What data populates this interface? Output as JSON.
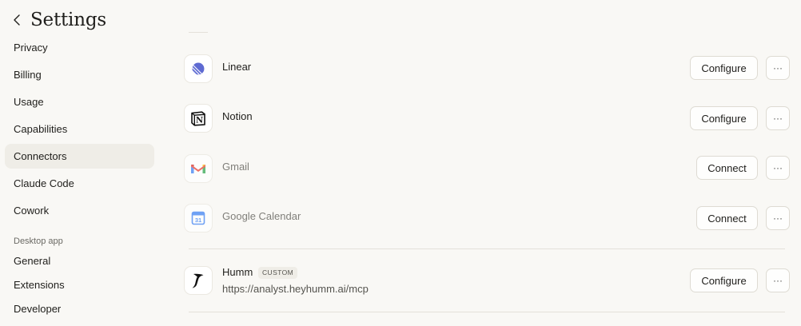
{
  "header": {
    "back_glyph": "‹",
    "title": "Settings"
  },
  "sidebar": {
    "items": [
      {
        "label": "Privacy"
      },
      {
        "label": "Billing"
      },
      {
        "label": "Usage"
      },
      {
        "label": "Capabilities"
      },
      {
        "label": "Connectors",
        "active": true
      },
      {
        "label": "Claude Code"
      },
      {
        "label": "Cowork"
      }
    ],
    "section_label": "Desktop app",
    "desktop_items": [
      {
        "label": "General"
      },
      {
        "label": "Extensions"
      },
      {
        "label": "Developer"
      }
    ]
  },
  "connectors": [
    {
      "name": "Linear",
      "icon": "linear-icon",
      "action": "Configure",
      "more": "···",
      "connected": true
    },
    {
      "name": "Notion",
      "icon": "notion-icon",
      "action": "Configure",
      "more": "···",
      "connected": true
    },
    {
      "name": "Gmail",
      "icon": "gmail-icon",
      "action": "Connect",
      "more": "···",
      "connected": false
    },
    {
      "name": "Google Calendar",
      "icon": "google-calendar-icon",
      "calendar_day": "31",
      "action": "Connect",
      "more": "···",
      "connected": false
    },
    {
      "name": "Humm",
      "badge": "CUSTOM",
      "url": "https://analyst.heyhumm.ai/mcp",
      "icon": "humm-icon",
      "action": "Configure",
      "more": "···",
      "connected": true
    }
  ],
  "colors": {
    "background": "#f9f8f5",
    "active_nav": "#efede7",
    "linear_accent": "#5e6ad2",
    "gmail_red": "#ea4335",
    "gmail_blue": "#4285f4",
    "gcal_blue": "#4285f4"
  }
}
